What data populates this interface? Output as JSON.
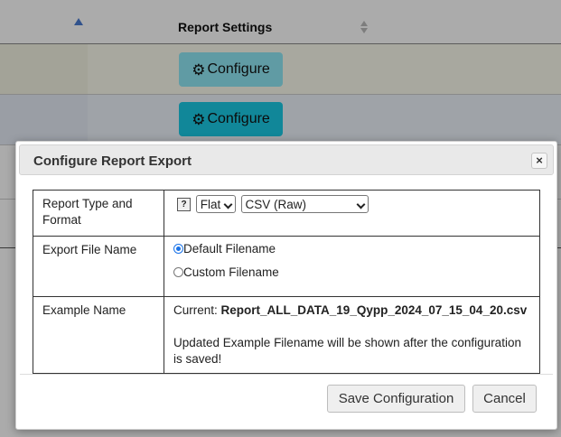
{
  "background": {
    "header": {
      "column_title": "Report Settings",
      "sort_up_icon": "sort-ascending-icon",
      "sort_both_icon": "sort-icon"
    },
    "rows": [
      {
        "configure_label": "Configure",
        "icon": "gear-icon"
      },
      {
        "configure_label": "Configure",
        "icon": "gear-icon"
      }
    ]
  },
  "dialog": {
    "title": "Configure Report Export",
    "close_symbol": "×",
    "fields": {
      "report_type": {
        "label": "Report Type and Format",
        "help_symbol": "?",
        "type_selected": "Flat",
        "format_selected": "CSV (Raw)"
      },
      "export_name": {
        "label": "Export File Name",
        "options": [
          "Default Filename",
          "Custom Filename"
        ],
        "selected": "Default Filename"
      },
      "example": {
        "label": "Example Name",
        "current_prefix": "Current:",
        "current_file": "Report_ALL_DATA_19_Qypp_2024_07_15_04_20.csv",
        "note": "Updated Example Filename will be shown after the configuration is saved!"
      }
    },
    "buttons": {
      "save": "Save Configuration",
      "cancel": "Cancel"
    }
  },
  "colors": {
    "configure_button_active": "#1ac9e4",
    "configure_button_faded": "#8fe8f5",
    "radio_accent": "#1a73e8",
    "dialog_titlebar": "#e9e9e9"
  }
}
